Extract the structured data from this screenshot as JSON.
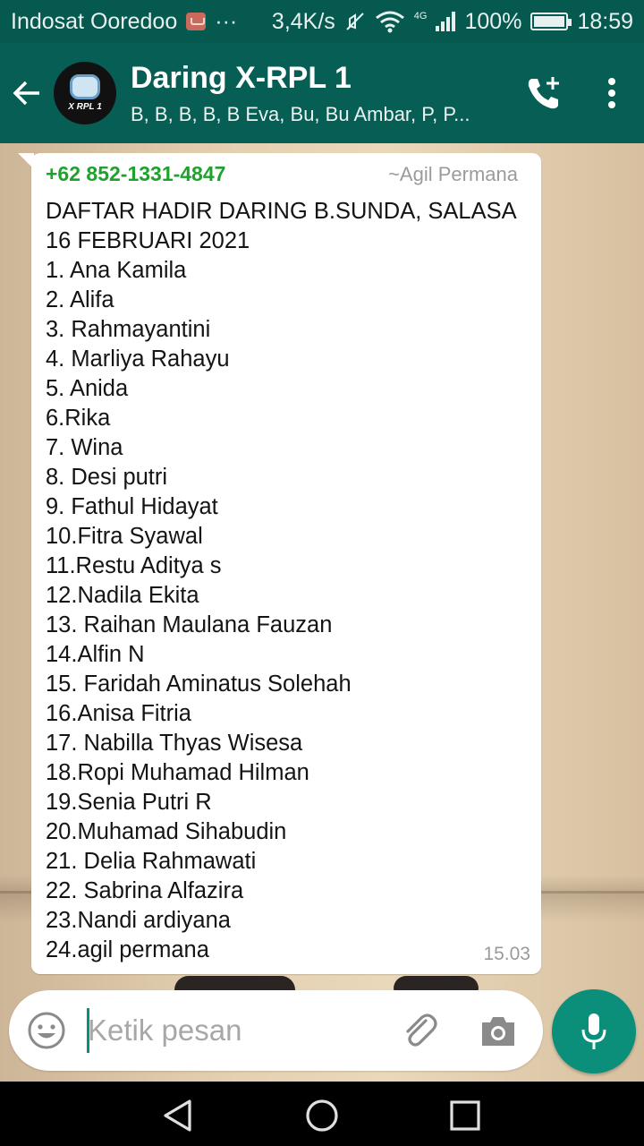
{
  "status_bar": {
    "carrier": "Indosat Ooredoo",
    "more": "···",
    "net_speed": "3,4K/s",
    "network_type": "4G",
    "battery": "100%",
    "time": "18:59"
  },
  "header": {
    "title": "Daring X-RPL 1",
    "members": "B, B, B, B, B Eva, Bu, Bu Ambar, P, P...",
    "avatar_text": "X RPL 1"
  },
  "message": {
    "sender_phone": "+62 852-1331-4847",
    "sender_name": "~Agil Permana",
    "lines": [
      "DAFTAR HADIR DARING B.SUNDA, SALASA",
      "16  FEBRUARI 2021",
      "1. Ana Kamila",
      "2. Alifa",
      "3. Rahmayantini",
      "4. Marliya Rahayu",
      "5. Anida",
      "6.Rika",
      "7. Wina",
      "8. Desi putri",
      "9. Fathul Hidayat",
      "10.Fitra Syawal",
      "11.Restu Aditya s",
      "12.Nadila Ekita",
      "13. Raihan Maulana Fauzan",
      "14.Alfin N",
      "15. Faridah Aminatus Solehah",
      "16.Anisa Fitria",
      "17. Nabilla Thyas Wisesa",
      "18.Ropi Muhamad Hilman",
      "19.Senia Putri R",
      "20.Muhamad Sihabudin",
      "21. Delia Rahmawati",
      "22. Sabrina Alfazira",
      "23.Nandi ardiyana",
      "24.agil permana"
    ],
    "time": "15.03"
  },
  "composer": {
    "placeholder": "Ketik pesan"
  },
  "colors": {
    "header": "#075e54",
    "status_bar": "#06594f",
    "sender_phone": "#1fa12d",
    "mic_button": "#0b8f7b"
  },
  "icons": [
    "back-arrow-icon",
    "add-call-icon",
    "more-vert-icon",
    "emoji-icon",
    "attach-icon",
    "camera-icon",
    "mic-icon",
    "nav-back-icon",
    "nav-home-icon",
    "nav-recents-icon"
  ]
}
